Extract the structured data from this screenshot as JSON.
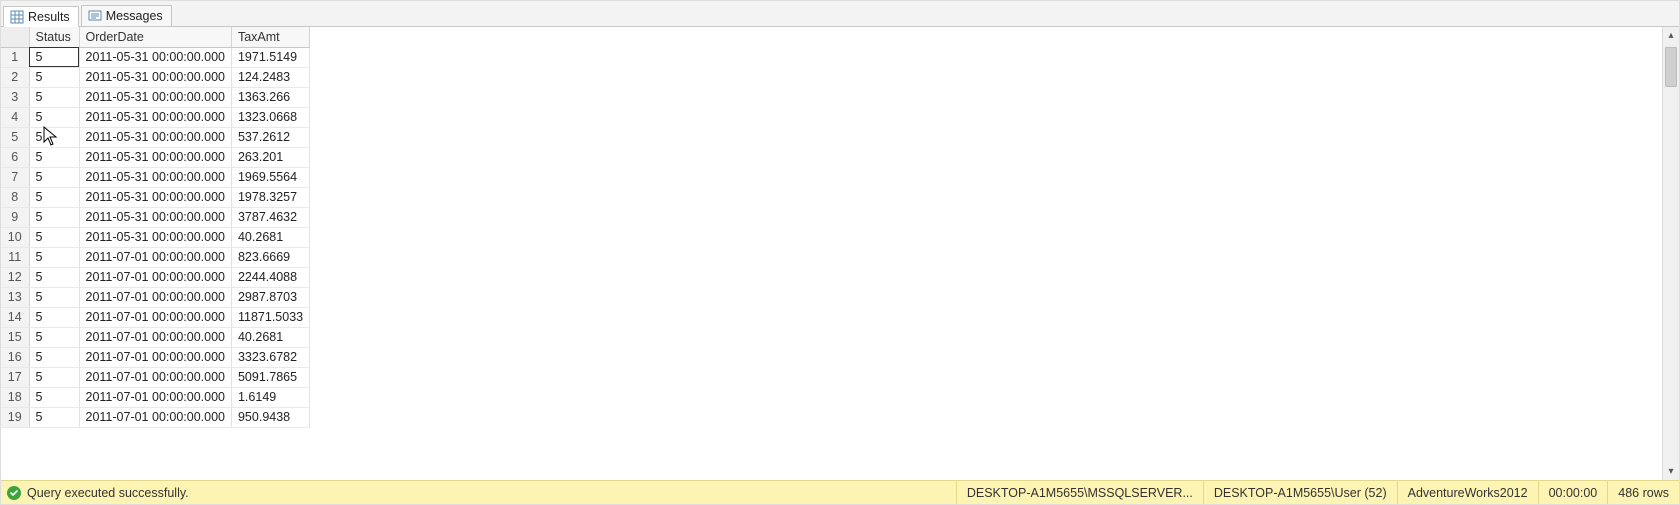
{
  "tabs": {
    "results": {
      "label": "Results"
    },
    "messages": {
      "label": "Messages"
    }
  },
  "grid": {
    "columns": [
      "Status",
      "OrderDate",
      "TaxAmt"
    ],
    "rows": [
      {
        "n": "1",
        "Status": "5",
        "OrderDate": "2011-05-31 00:00:00.000",
        "TaxAmt": "1971.5149"
      },
      {
        "n": "2",
        "Status": "5",
        "OrderDate": "2011-05-31 00:00:00.000",
        "TaxAmt": "124.2483"
      },
      {
        "n": "3",
        "Status": "5",
        "OrderDate": "2011-05-31 00:00:00.000",
        "TaxAmt": "1363.266"
      },
      {
        "n": "4",
        "Status": "5",
        "OrderDate": "2011-05-31 00:00:00.000",
        "TaxAmt": "1323.0668"
      },
      {
        "n": "5",
        "Status": "5",
        "OrderDate": "2011-05-31 00:00:00.000",
        "TaxAmt": "537.2612"
      },
      {
        "n": "6",
        "Status": "5",
        "OrderDate": "2011-05-31 00:00:00.000",
        "TaxAmt": "263.201"
      },
      {
        "n": "7",
        "Status": "5",
        "OrderDate": "2011-05-31 00:00:00.000",
        "TaxAmt": "1969.5564"
      },
      {
        "n": "8",
        "Status": "5",
        "OrderDate": "2011-05-31 00:00:00.000",
        "TaxAmt": "1978.3257"
      },
      {
        "n": "9",
        "Status": "5",
        "OrderDate": "2011-05-31 00:00:00.000",
        "TaxAmt": "3787.4632"
      },
      {
        "n": "10",
        "Status": "5",
        "OrderDate": "2011-05-31 00:00:00.000",
        "TaxAmt": "40.2681"
      },
      {
        "n": "11",
        "Status": "5",
        "OrderDate": "2011-07-01 00:00:00.000",
        "TaxAmt": "823.6669"
      },
      {
        "n": "12",
        "Status": "5",
        "OrderDate": "2011-07-01 00:00:00.000",
        "TaxAmt": "2244.4088"
      },
      {
        "n": "13",
        "Status": "5",
        "OrderDate": "2011-07-01 00:00:00.000",
        "TaxAmt": "2987.8703"
      },
      {
        "n": "14",
        "Status": "5",
        "OrderDate": "2011-07-01 00:00:00.000",
        "TaxAmt": "11871.5033"
      },
      {
        "n": "15",
        "Status": "5",
        "OrderDate": "2011-07-01 00:00:00.000",
        "TaxAmt": "40.2681"
      },
      {
        "n": "16",
        "Status": "5",
        "OrderDate": "2011-07-01 00:00:00.000",
        "TaxAmt": "3323.6782"
      },
      {
        "n": "17",
        "Status": "5",
        "OrderDate": "2011-07-01 00:00:00.000",
        "TaxAmt": "5091.7865"
      },
      {
        "n": "18",
        "Status": "5",
        "OrderDate": "2011-07-01 00:00:00.000",
        "TaxAmt": "1.6149"
      },
      {
        "n": "19",
        "Status": "5",
        "OrderDate": "2011-07-01 00:00:00.000",
        "TaxAmt": "950.9438"
      }
    ]
  },
  "status": {
    "message": "Query executed successfully.",
    "server": "DESKTOP-A1M5655\\MSSQLSERVER...",
    "login": "DESKTOP-A1M5655\\User (52)",
    "database": "AdventureWorks2012",
    "elapsed": "00:00:00",
    "rows": "486 rows"
  }
}
